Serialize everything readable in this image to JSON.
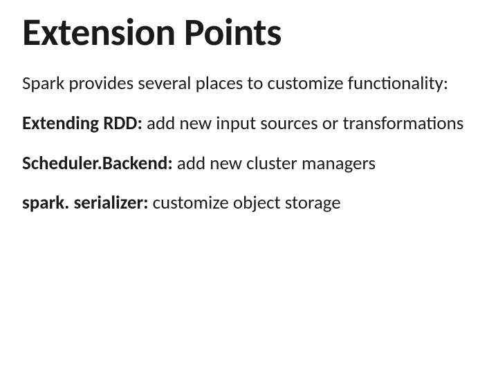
{
  "slide": {
    "title": "Extension Points",
    "intro": "Spark provides several places to customize functionality:",
    "points": [
      {
        "lead": "Extending RDD:",
        "rest": " add new input sources or transformations"
      },
      {
        "lead": "Scheduler.Backend:",
        "rest": " add new cluster managers"
      },
      {
        "lead": "spark. serializer:",
        "rest": " customize object storage"
      }
    ]
  }
}
